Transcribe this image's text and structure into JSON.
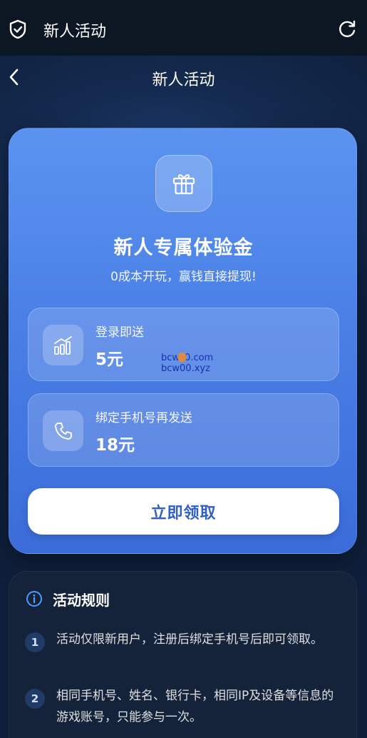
{
  "system_bar": {
    "title": "新人活动",
    "shield_icon": "shield-check-icon",
    "refresh_icon": "refresh-icon"
  },
  "nav": {
    "title": "新人活动",
    "back_icon": "chevron-left-icon"
  },
  "promo": {
    "icon": "gift-icon",
    "headline": "新人专属体验金",
    "subline": "0成本开玩，赢钱直接提现!",
    "rewards": [
      {
        "icon": "bar-chart-icon",
        "label": "登录即送",
        "amount": "5元"
      },
      {
        "icon": "phone-icon",
        "label": "绑定手机号再发送",
        "amount": "18元"
      }
    ],
    "watermark": {
      "line1_a": "bcw",
      "line1_b": "0.com",
      "line2": "bcw00.xyz"
    },
    "claim_label": "立即领取"
  },
  "rules": {
    "title": "活动规则",
    "icon": "info-circle-icon",
    "items": [
      {
        "num": "1",
        "text": "活动仅限新用户，注册后绑定手机号后即可领取。"
      },
      {
        "num": "2",
        "text": "相同手机号、姓名、银行卡，相同IP及设备等信息的游戏账号，只能参与一次。"
      }
    ]
  },
  "colors": {
    "card_top": "#5b93f0",
    "card_bottom": "#3b6cd9",
    "claim_text": "#2f5fc9",
    "background": "#0f1a30"
  }
}
